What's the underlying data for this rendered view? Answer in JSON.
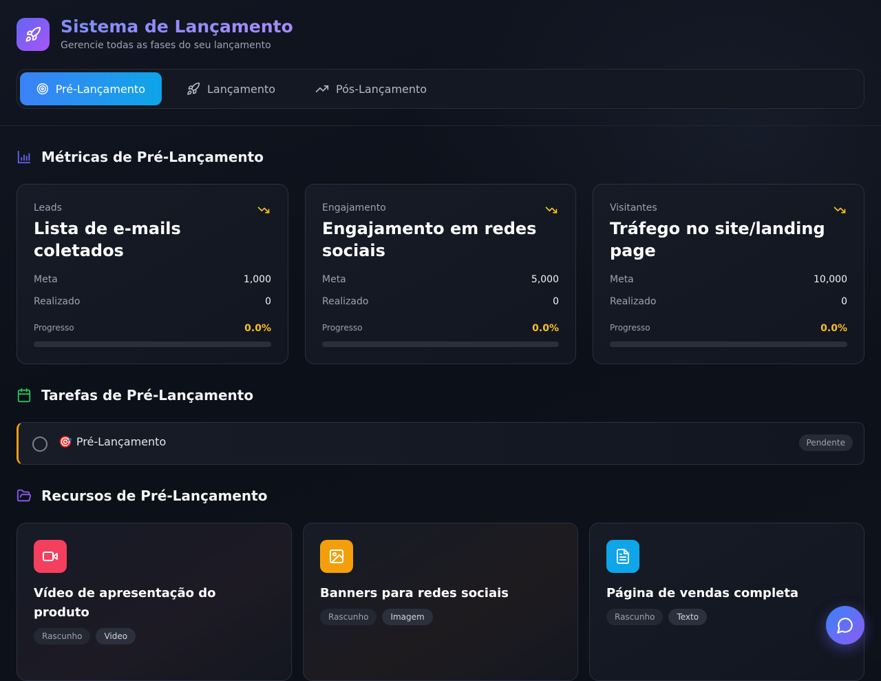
{
  "app": {
    "title": "Sistema de Lançamento",
    "subtitle": "Gerencie todas as fases do seu lançamento",
    "logo_icon": "rocket-icon"
  },
  "tabs": [
    {
      "label": "Pré-Lançamento",
      "icon": "target-icon",
      "active": true
    },
    {
      "label": "Lançamento",
      "icon": "rocket-icon",
      "active": false
    },
    {
      "label": "Pós-Lançamento",
      "icon": "trending-up-icon",
      "active": false
    }
  ],
  "metrics_section": {
    "title": "Métricas de Pré-Lançamento",
    "icon": "bar-chart-icon"
  },
  "metrics": [
    {
      "label": "Leads",
      "title": "Lista de e-mails coletados",
      "meta_label": "Meta",
      "meta": "1,000",
      "realizado_label": "Realizado",
      "realizado": "0",
      "progress_label": "Progresso",
      "progress": "0.0%",
      "progress_value": 0
    },
    {
      "label": "Engajamento",
      "title": "Engajamento em redes sociais",
      "meta_label": "Meta",
      "meta": "5,000",
      "realizado_label": "Realizado",
      "realizado": "0",
      "progress_label": "Progresso",
      "progress": "0.0%",
      "progress_value": 0
    },
    {
      "label": "Visitantes",
      "title": "Tráfego no site/landing page",
      "meta_label": "Meta",
      "meta": "10,000",
      "realizado_label": "Realizado",
      "realizado": "0",
      "progress_label": "Progresso",
      "progress": "0.0%",
      "progress_value": 0
    }
  ],
  "tasks_section": {
    "title": "Tarefas de Pré-Lançamento",
    "icon": "calendar-icon"
  },
  "tasks": [
    {
      "emoji": "🎯",
      "title": "Pré-Lançamento",
      "status": "Pendente"
    }
  ],
  "resources_section": {
    "title": "Recursos de Pré-Lançamento",
    "icon": "folder-open-icon"
  },
  "resources": [
    {
      "title": "Vídeo de apresentação do produto",
      "status": "Rascunho",
      "type": "Video",
      "icon": "video-icon",
      "color": "#f43f5e"
    },
    {
      "title": "Banners para redes sociais",
      "status": "Rascunho",
      "type": "Imagem",
      "icon": "image-icon",
      "color": "#f59e0b"
    },
    {
      "title": "Página de vendas completa",
      "status": "Rascunho",
      "type": "Texto",
      "icon": "file-text-icon",
      "color": "#0ea5e9"
    }
  ],
  "colors": {
    "accent": "#3b82f6",
    "warning": "#fbbf24",
    "brand": "#8b5cf6"
  },
  "fab": {
    "icon": "chat-icon"
  }
}
